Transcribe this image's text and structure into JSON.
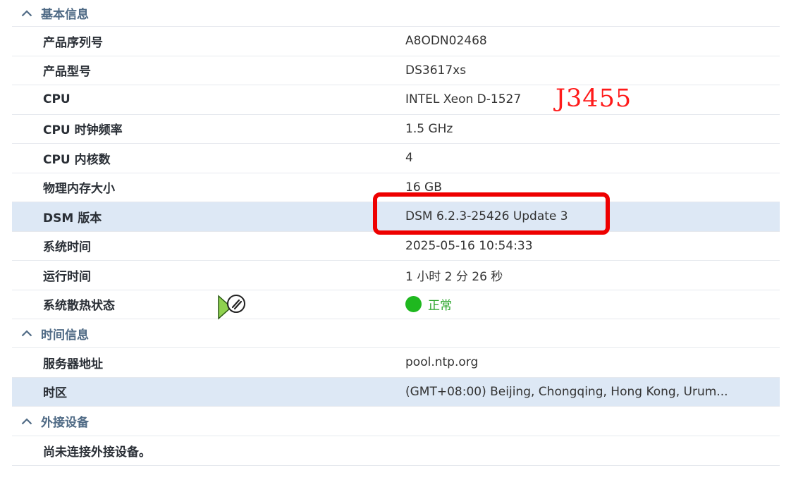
{
  "sections": [
    {
      "title": "基本信息",
      "rows": [
        {
          "label": "产品序列号",
          "value": "A8ODN02468"
        },
        {
          "label": "产品型号",
          "value": "DS3617xs"
        },
        {
          "label": "CPU",
          "value": "INTEL Xeon D-1527"
        },
        {
          "label": "CPU 时钟频率",
          "value": "1.5 GHz"
        },
        {
          "label": "CPU 内核数",
          "value": "4"
        },
        {
          "label": "物理内存大小",
          "value": "16 GB"
        },
        {
          "label": "DSM 版本",
          "value": "DSM 6.2.3-25426 Update 3"
        },
        {
          "label": "系统时间",
          "value": "2025-05-16 10:54:33"
        },
        {
          "label": "运行时间",
          "value": "1 小时 2 分 26 秒"
        },
        {
          "label": "系统散热状态",
          "value": "正常"
        }
      ]
    },
    {
      "title": "时间信息",
      "rows": [
        {
          "label": "服务器地址",
          "value": "pool.ntp.org"
        },
        {
          "label": "时区",
          "value": "(GMT+08:00) Beijing, Chongqing, Hong Kong, Urum..."
        }
      ]
    },
    {
      "title": "外接设备",
      "rows": [
        {
          "label": "尚未连接外接设备。",
          "value": ""
        }
      ]
    }
  ],
  "annotation": {
    "text": "J3455",
    "color": "#ff1a1a",
    "highlight_color": "#ee0000"
  },
  "colors": {
    "section_title": "#4f6a85",
    "selected_row": "#dde8f5",
    "status_ok": "#1fb81f"
  },
  "icons": {
    "section_toggle": "chevron-up-icon",
    "thermal_status": "status-ok-dot-icon",
    "cursor": "link-cursor-icon"
  }
}
